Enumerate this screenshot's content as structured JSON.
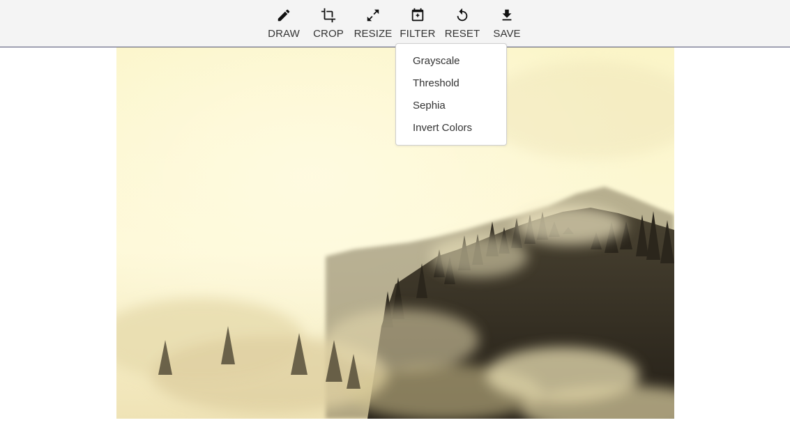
{
  "toolbar": {
    "tools": [
      {
        "label": "DRAW",
        "icon": "pencil-icon"
      },
      {
        "label": "CROP",
        "icon": "crop-icon"
      },
      {
        "label": "RESIZE",
        "icon": "resize-icon"
      },
      {
        "label": "FILTER",
        "icon": "filter-icon"
      },
      {
        "label": "RESET",
        "icon": "reset-icon"
      },
      {
        "label": "SAVE",
        "icon": "download-icon"
      }
    ]
  },
  "filter_menu": {
    "items": [
      "Grayscale",
      "Threshold",
      "Sephia",
      "Invert Colors"
    ]
  },
  "colors": {
    "toolbar_bg": "#f4f4f4",
    "toolbar_border": "#4a4d6e",
    "sepia_light": "#fbf5c8",
    "sepia_dark": "#2f2a1f",
    "text": "#333333"
  }
}
